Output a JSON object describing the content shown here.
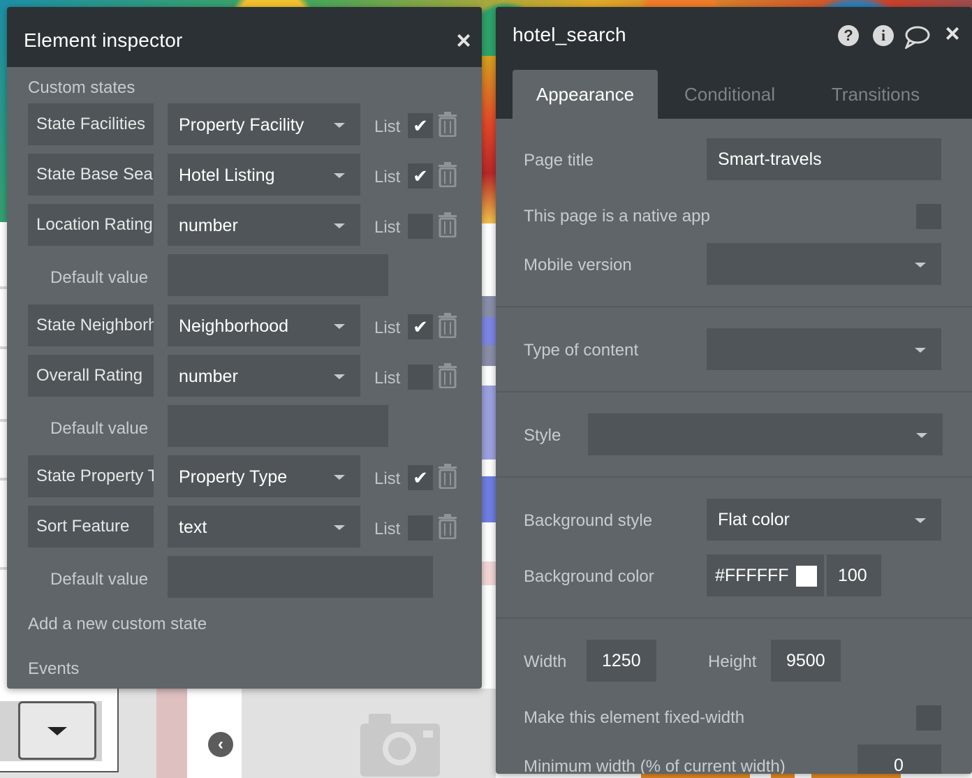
{
  "inspector": {
    "title": "Element inspector",
    "close_icon": "close-icon",
    "custom_states_label": "Custom states",
    "states": [
      {
        "name": "State Facilities",
        "type": "Property Facility",
        "list_label": "List",
        "is_list": true
      },
      {
        "name": "State Base Search",
        "type": "Hotel Listing",
        "list_label": "List",
        "is_list": true
      },
      {
        "name": "Location Rating",
        "type": "number",
        "list_label": "List",
        "is_list": false
      },
      {
        "name": "State Neighborhood",
        "type": "Neighborhood",
        "list_label": "List",
        "is_list": true
      },
      {
        "name": "Overall Rating",
        "type": "number",
        "list_label": "List",
        "is_list": false
      },
      {
        "name": "State Property Type",
        "type": "Property Type",
        "list_label": "List",
        "is_list": true
      },
      {
        "name": "Sort Feature",
        "type": "text",
        "list_label": "List",
        "is_list": false
      }
    ],
    "default_value_label": "Default value",
    "add_state_label": "Add a new custom state",
    "events_label": "Events"
  },
  "editor": {
    "title": "hotel_search",
    "header_icons": [
      "help-icon",
      "info-icon",
      "comment-icon",
      "close-icon"
    ],
    "tabs": [
      "Appearance",
      "Conditional",
      "Transitions"
    ],
    "active_tab": "Appearance",
    "page_title_label": "Page title",
    "page_title_value": "Smart-travels",
    "native_app_label": "This page is a native app",
    "mobile_version_label": "Mobile version",
    "type_of_content_label": "Type of content",
    "style_label": "Style",
    "background_style_label": "Background style",
    "background_style_value": "Flat color",
    "background_color_label": "Background color",
    "background_color_value": "#FFFFFF",
    "background_opacity": "100",
    "width_label": "Width",
    "width_value": "1250",
    "height_label": "Height",
    "height_value": "9500",
    "fixed_width_label": "Make this element fixed-width",
    "min_width_label": "Minimum width (% of current width)",
    "min_width_value": "0"
  },
  "colors": {
    "panel": "#5f6568",
    "header": "#2b3134",
    "field": "#4f5558",
    "text": "#c7cccf"
  }
}
